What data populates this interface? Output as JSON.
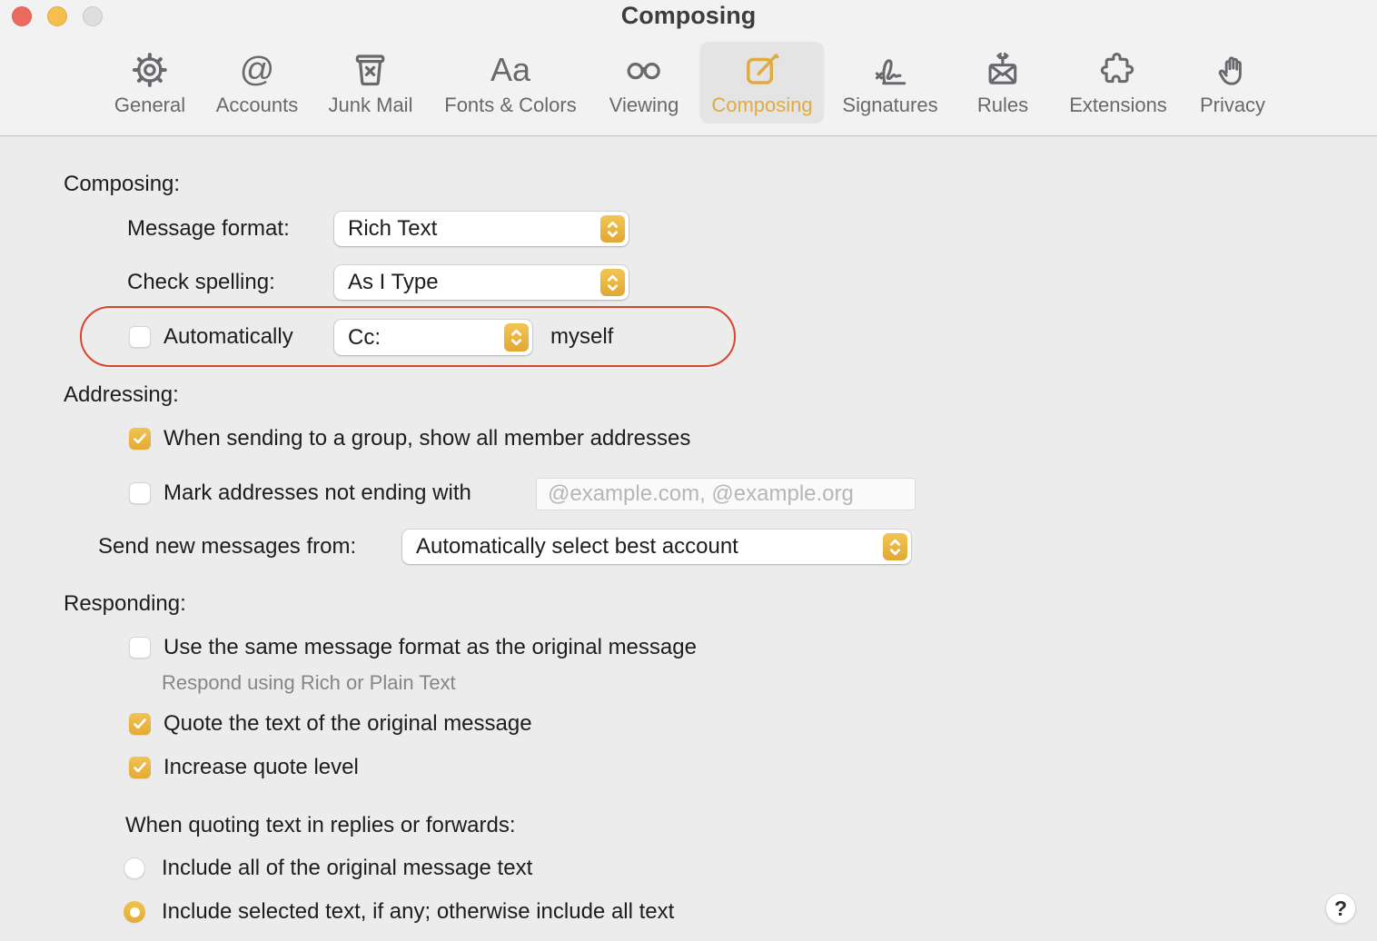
{
  "window": {
    "title": "Composing"
  },
  "toolbar": {
    "items": [
      {
        "label": "General",
        "selected": false
      },
      {
        "label": "Accounts",
        "selected": false
      },
      {
        "label": "Junk Mail",
        "selected": false
      },
      {
        "label": "Fonts & Colors",
        "selected": false
      },
      {
        "label": "Viewing",
        "selected": false
      },
      {
        "label": "Composing",
        "selected": true
      },
      {
        "label": "Signatures",
        "selected": false
      },
      {
        "label": "Rules",
        "selected": false
      },
      {
        "label": "Extensions",
        "selected": false
      },
      {
        "label": "Privacy",
        "selected": false
      }
    ]
  },
  "sections": {
    "composing": {
      "heading": "Composing:",
      "message_format": {
        "label": "Message format:",
        "value": "Rich Text"
      },
      "check_spelling": {
        "label": "Check spelling:",
        "value": "As I Type"
      },
      "auto_cc": {
        "checked": false,
        "label": "Automatically",
        "value": "Cc:",
        "suffix": "myself"
      }
    },
    "addressing": {
      "heading": "Addressing:",
      "group_option": {
        "checked": true,
        "label": "When sending to a group, show all member addresses"
      },
      "mark_option": {
        "checked": false,
        "label": "Mark addresses not ending with",
        "placeholder": "@example.com, @example.org",
        "value": ""
      },
      "send_from": {
        "label": "Send new messages from:",
        "value": "Automatically select best account"
      }
    },
    "responding": {
      "heading": "Responding:",
      "same_format": {
        "checked": false,
        "label": "Use the same message format as the original message",
        "sublabel": "Respond using Rich or Plain Text"
      },
      "quote_text": {
        "checked": true,
        "label": "Quote the text of the original message"
      },
      "increase_quote": {
        "checked": true,
        "label": "Increase quote level"
      },
      "quoting": {
        "label": "When quoting text in replies or forwards:",
        "options": [
          {
            "label": "Include all of the original message text",
            "selected": false
          },
          {
            "label": "Include selected text, if any; otherwise include all text",
            "selected": true
          }
        ]
      }
    }
  },
  "help": {
    "label": "?"
  },
  "colors": {
    "accent": "#e2ae41",
    "accent_dark": "#e1a833",
    "tab_selected_text": "#dfab3e",
    "annotation": "#d7452e",
    "header_bg": "#f3f2f2",
    "content_bg": "#ececec",
    "traffic_red": "#ed6a5e",
    "traffic_yellow": "#f5bf4f",
    "traffic_gray": "#dedede"
  }
}
